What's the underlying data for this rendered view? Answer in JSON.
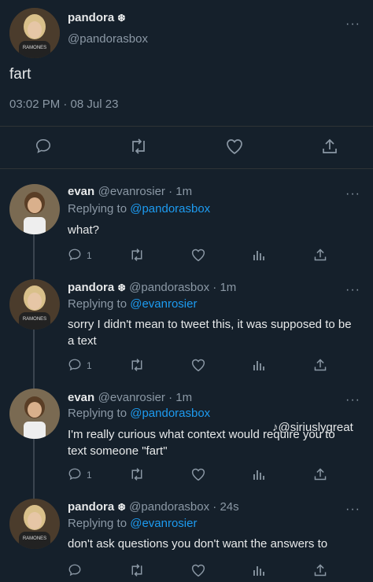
{
  "main_tweet": {
    "name": "pandora",
    "badge": "❆",
    "handle": "@pandorasbox",
    "text": "fart",
    "timestamp": "03:02 PM · 08 Jul 23",
    "more": "···"
  },
  "replies": [
    {
      "name": "evan",
      "handle_time": "@evanrosier · 1m",
      "replying_prefix": "Replying to ",
      "replying_to": "@pandorasbox",
      "text": "what?",
      "reply_count": "1",
      "more": "···"
    },
    {
      "name": "pandora",
      "badge": "❆",
      "handle_time": "@pandorasbox · 1m",
      "replying_prefix": "Replying to ",
      "replying_to": "@evanrosier",
      "text": "sorry I didn't mean to tweet this, it was supposed to be a text",
      "reply_count": "1",
      "more": "···"
    },
    {
      "name": "evan",
      "handle_time": "@evanrosier · 1m",
      "replying_prefix": "Replying to ",
      "replying_to": "@pandorasbox",
      "text": "I'm really curious what context would require you to text someone \"fart\"",
      "reply_count": "1",
      "more": "···"
    },
    {
      "name": "pandora",
      "badge": "❆",
      "handle_time": "@pandorasbox · 24s",
      "replying_prefix": "Replying to ",
      "replying_to": "@evanrosier",
      "text": "don't ask questions you don't want the answers to",
      "reply_count": "",
      "more": "···"
    }
  ],
  "watermark": "@siriuslygreat",
  "colors": {
    "background": "#15202b",
    "link": "#1d9bf0",
    "muted": "#8b98a5"
  }
}
